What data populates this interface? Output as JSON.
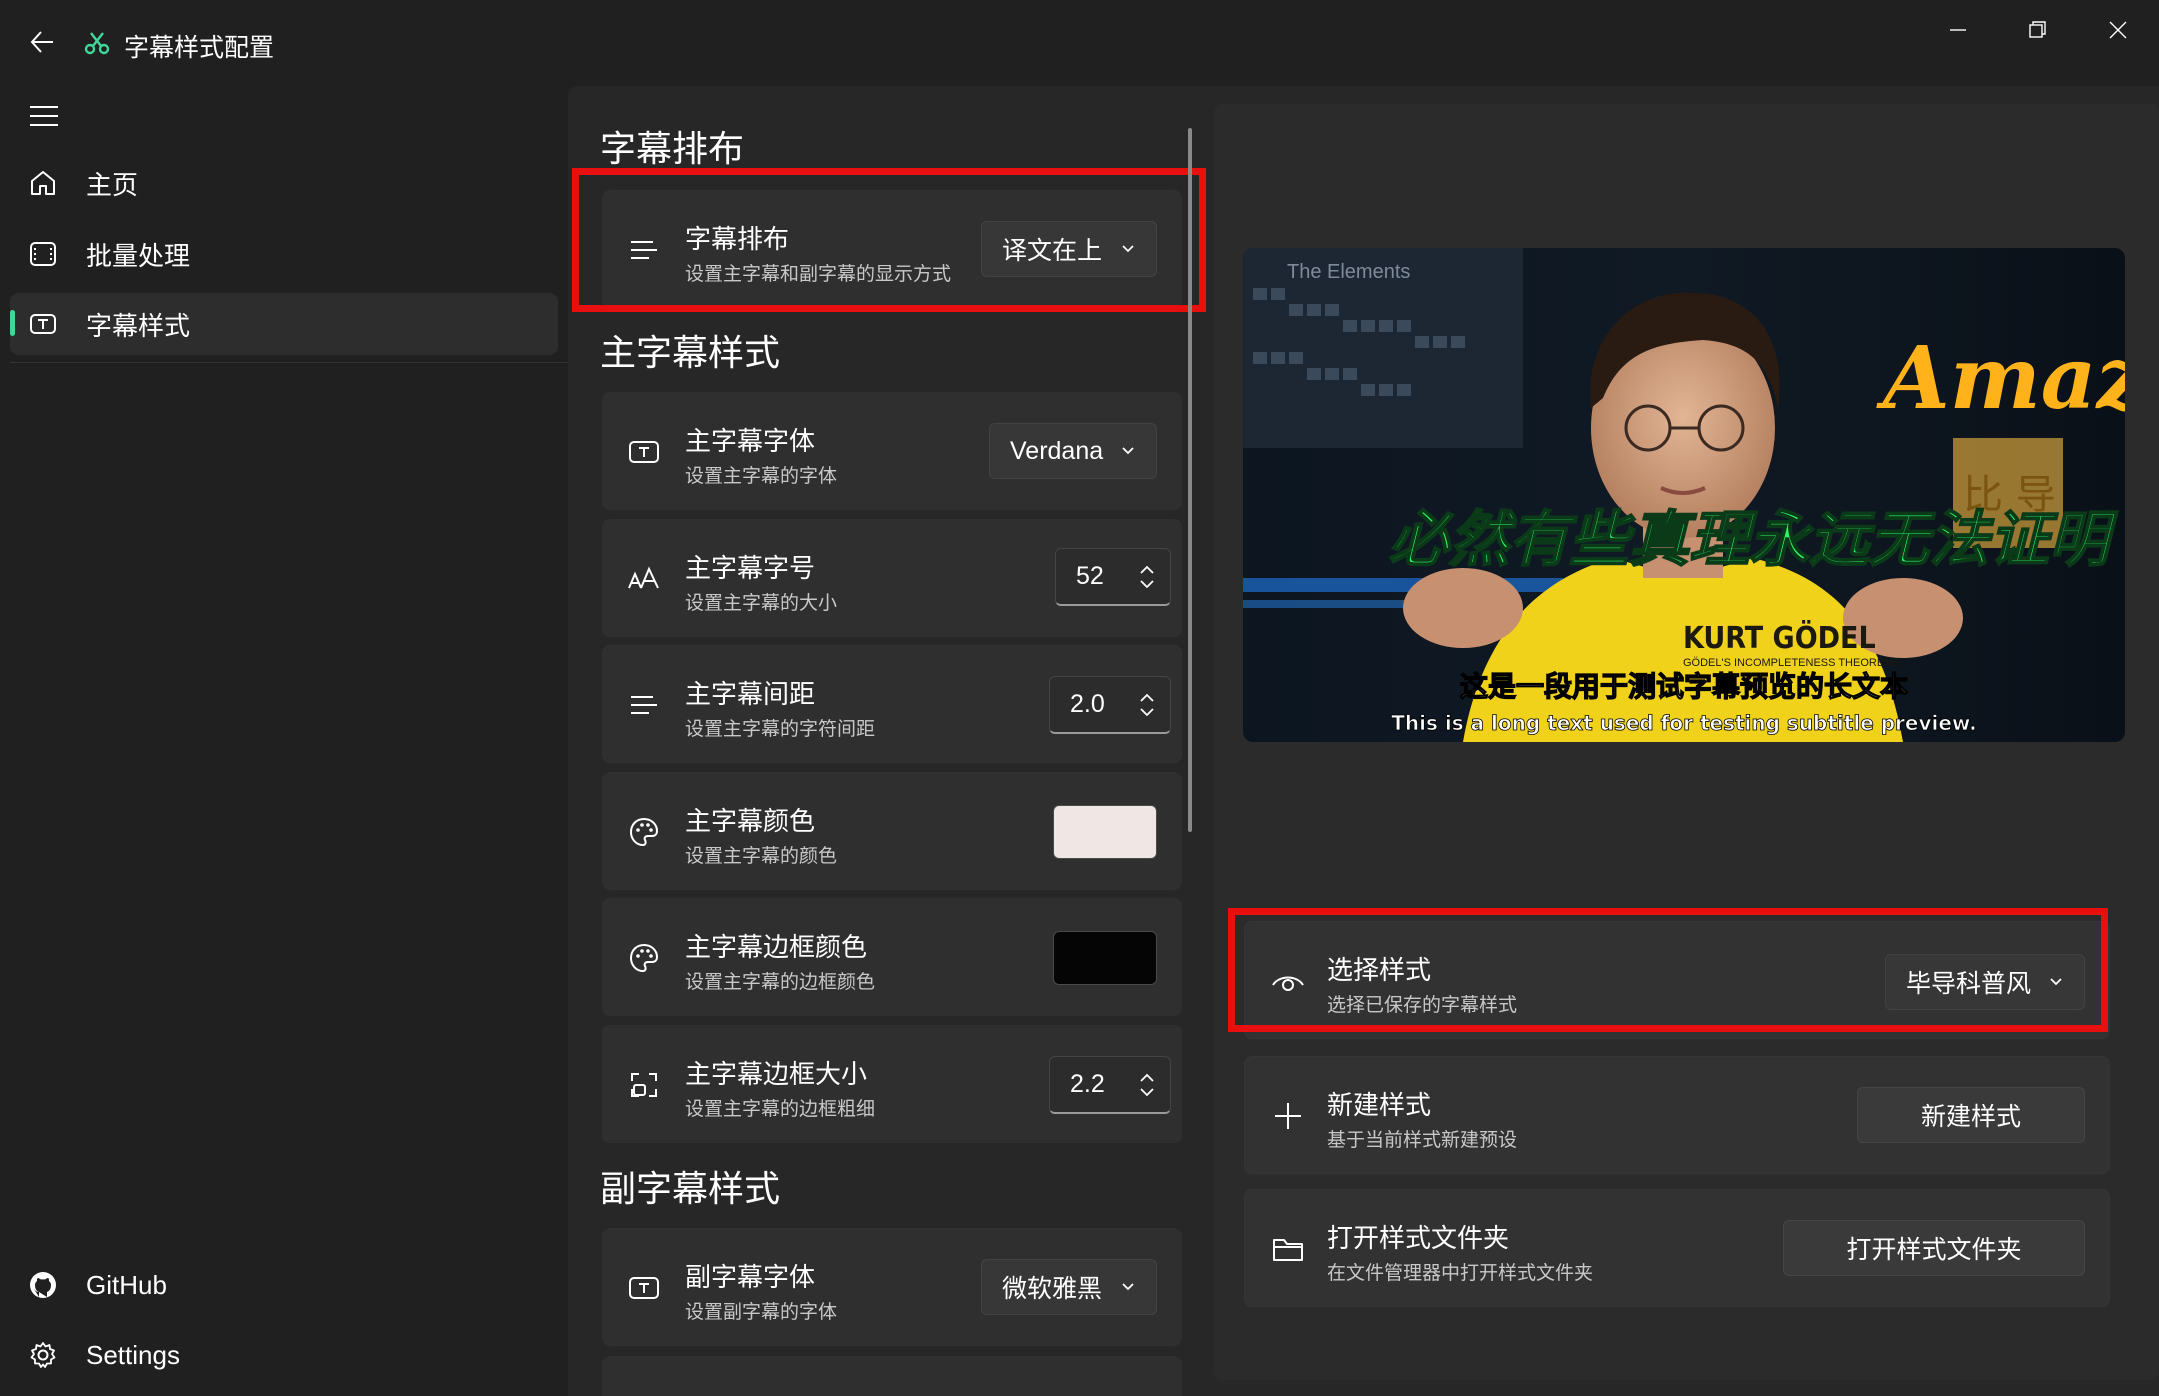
{
  "window": {
    "title": "字幕样式配置",
    "app_icon": "scissors-icon",
    "controls": [
      "minimize-icon",
      "restore-icon",
      "close-icon"
    ]
  },
  "sidebar": {
    "menu_icon": "hamburger-icon",
    "items": [
      {
        "label": "主页",
        "icon": "home-icon"
      },
      {
        "label": "批量处理",
        "icon": "batch-icon"
      },
      {
        "label": "字幕样式",
        "icon": "text-box-icon",
        "selected": true
      }
    ],
    "footer": [
      {
        "label": "GitHub",
        "icon": "github-icon"
      },
      {
        "label": "Settings",
        "icon": "gear-icon"
      }
    ],
    "accent_color": "#3fd89a"
  },
  "main": {
    "layout_section": {
      "title": "字幕排布",
      "card": {
        "title": "字幕排布",
        "desc": "设置主字幕和副字幕的显示方式",
        "value": "译文在上",
        "icon": "align-lines-icon"
      }
    },
    "main_section": {
      "title": "主字幕样式",
      "cards": [
        {
          "title": "主字幕字体",
          "desc": "设置主字幕的字体",
          "value": "Verdana",
          "icon": "font-icon"
        },
        {
          "title": "主字幕字号",
          "desc": "设置主字幕的大小",
          "value": "52",
          "icon": "font-size-icon"
        },
        {
          "title": "主字幕间距",
          "desc": "设置主字幕的字符间距",
          "value": "2.0",
          "icon": "align-lines-icon"
        },
        {
          "title": "主字幕颜色",
          "desc": "设置主字幕的颜色",
          "color": "#f0e6e4",
          "icon": "palette-icon"
        },
        {
          "title": "主字幕边框颜色",
          "desc": "设置主字幕的边框颜色",
          "color": "#050505",
          "icon": "palette-icon"
        },
        {
          "title": "主字幕边框大小",
          "desc": "设置主字幕的边框粗细",
          "value": "2.2",
          "icon": "border-size-icon"
        }
      ]
    },
    "secondary_section": {
      "title": "副字幕样式",
      "cards": [
        {
          "title": "副字幕字体",
          "desc": "设置副字幕的字体",
          "value": "微软雅黑",
          "icon": "font-icon"
        }
      ]
    }
  },
  "preview": {
    "subtitle_main": "必然有些真理永远无法证明",
    "caption_cn": "这是一段用于测试字幕预览的长文本",
    "caption_en": "This is a long text used for testing subtitle preview.",
    "sign_text": "Amazin",
    "board_text": "The Elements",
    "shirt_text": "KURT GÖDEL",
    "shirt_subtext": "GÖDEL'S INCOMPLETENESS THEOREMS",
    "box_text": "比 导",
    "subtitle_color": "#2cf56a"
  },
  "right": {
    "select_style": {
      "title": "选择样式",
      "desc": "选择已保存的字幕样式",
      "value": "毕导科普风",
      "icon": "eye-icon"
    },
    "new_style": {
      "title": "新建样式",
      "desc": "基于当前样式新建预设",
      "button": "新建样式",
      "icon": "plus-icon"
    },
    "open_folder": {
      "title": "打开样式文件夹",
      "desc": "在文件管理器中打开样式文件夹",
      "button": "打开样式文件夹",
      "icon": "folder-icon"
    }
  },
  "highlight_color": "#e8100f"
}
